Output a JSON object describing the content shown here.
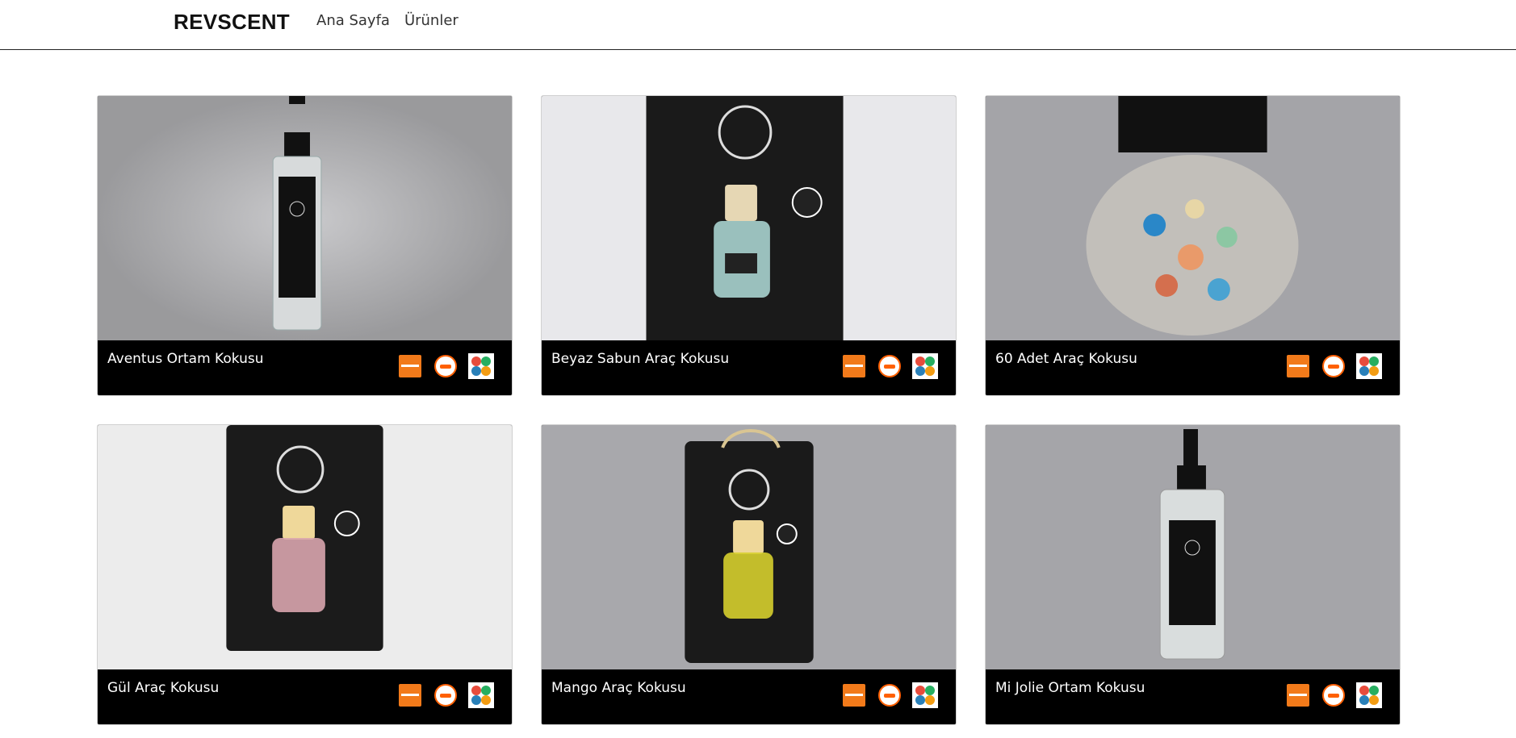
{
  "nav": {
    "brand": "REVSCENT",
    "links": [
      "Ana Sayfa",
      "Ürünler"
    ]
  },
  "products": [
    {
      "title": "Aventus Ortam Kokusu",
      "image": "spray-bottle-icon",
      "bg": "#a7a7ab"
    },
    {
      "title": "Beyaz Sabun Araç Kokusu",
      "image": "car-perfume-box-icon",
      "bg": "#e7e7ea"
    },
    {
      "title": "60 Adet Araç Kokusu",
      "image": "car-perfume-pack-icon",
      "bg": "#a4a4a8"
    },
    {
      "title": "Gül Araç Kokusu",
      "image": "car-perfume-box-icon",
      "bg": "#ececec"
    },
    {
      "title": "Mango Araç Kokusu",
      "image": "car-perfume-card-icon",
      "bg": "#a8a8ac"
    },
    {
      "title": "Mi Jolie Ortam Kokusu",
      "image": "spray-bottle-icon",
      "bg": "#a5a5a9"
    }
  ],
  "stores": [
    "trendyol-icon",
    "hepsiburada-icon",
    "n11-icon"
  ],
  "colors": {
    "accent_orange": "#f27a1a",
    "hepsiburada_orange": "#ff6000"
  }
}
